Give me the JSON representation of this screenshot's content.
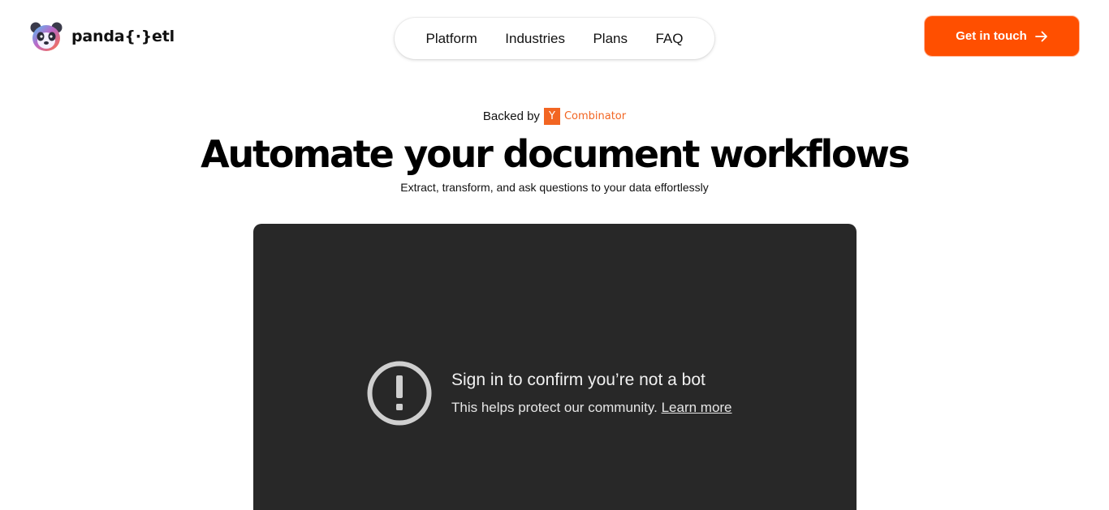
{
  "header": {
    "logo_text": "panda{·}etl",
    "nav": [
      "Platform",
      "Industries",
      "Plans",
      "FAQ"
    ],
    "cta_label": "Get in touch",
    "cta_color": "#ff4f00"
  },
  "hero": {
    "backed_label": "Backed by",
    "backer": {
      "mark": "Y",
      "name": "Combinator",
      "color": "#f26522"
    },
    "title": "Automate your document workflows",
    "subtitle": "Extract, transform, and ask questions to your data effortlessly"
  },
  "video": {
    "notice_title": "Sign in to confirm you’re not a bot",
    "notice_body": "This helps protect our community.",
    "learn_more": "Learn more",
    "icon": "alert-circle-icon"
  }
}
